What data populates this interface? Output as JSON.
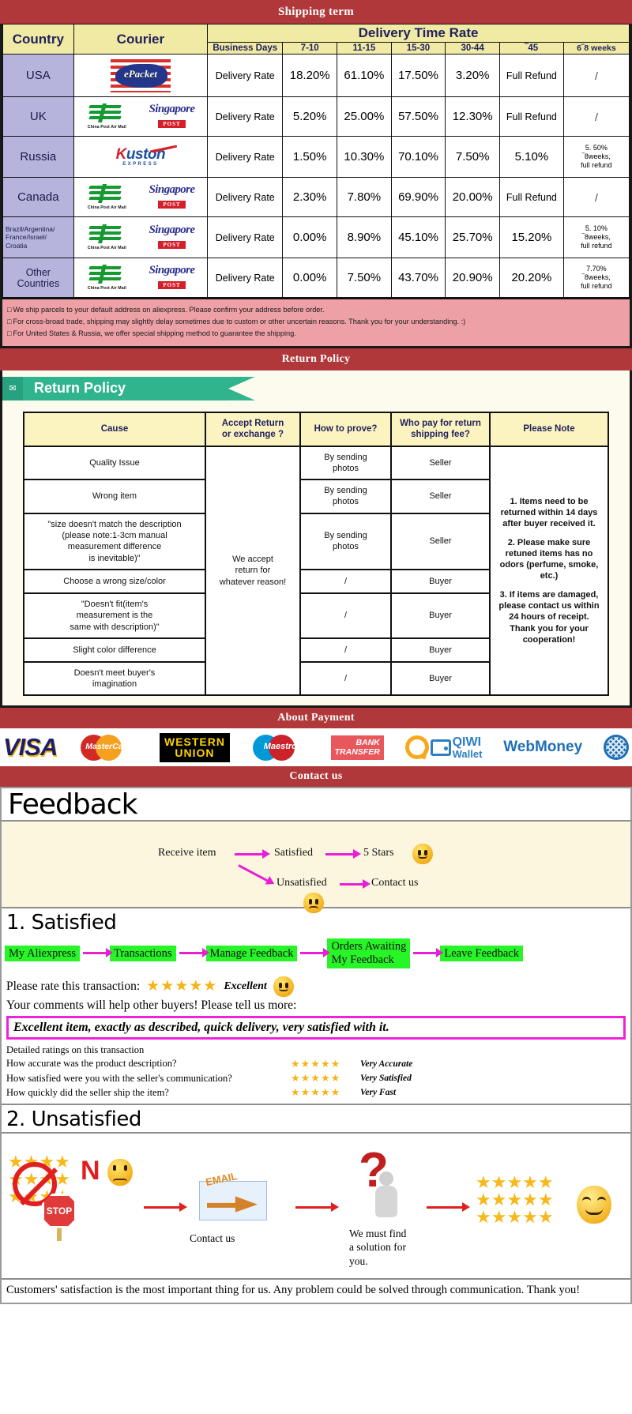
{
  "banners": {
    "shipping": "Shipping term",
    "return": "Return Policy",
    "payment": "About Payment",
    "contact": "Contact us"
  },
  "shipping_table": {
    "headers": {
      "country": "Country",
      "courier": "Courier",
      "group": "Delivery Time Rate",
      "business_days": "Business Days",
      "cols": [
        "7-10",
        "11-15",
        "15-30",
        "30-44",
        "‾45",
        "6‾8 weeks"
      ]
    },
    "rows": [
      {
        "country": "USA",
        "country_small": false,
        "couriers": [
          "epacket"
        ],
        "label": "Delivery Rate",
        "values": [
          "18.20%",
          "61.10%",
          "17.50%",
          "3.20%"
        ],
        "over45": "Full Refund",
        "weeks68": "/"
      },
      {
        "country": "UK",
        "country_small": false,
        "couriers": [
          "china-post",
          "singapore-post"
        ],
        "label": "Delivery Rate",
        "values": [
          "5.20%",
          "25.00%",
          "57.50%",
          "12.30%"
        ],
        "over45": "Full Refund",
        "weeks68": "/"
      },
      {
        "country": "Russia",
        "country_small": false,
        "couriers": [
          "kuston"
        ],
        "label": "Delivery Rate",
        "values": [
          "1.50%",
          "10.30%",
          "70.10%",
          "7.50%"
        ],
        "over45": "5.10%",
        "weeks68": "5. 50%\n‾8weeks,\nfull refund"
      },
      {
        "country": "Canada",
        "country_small": false,
        "couriers": [
          "china-post",
          "singapore-post"
        ],
        "label": "Delivery Rate",
        "values": [
          "2.30%",
          "7.80%",
          "69.90%",
          "20.00%"
        ],
        "over45": "Full Refund",
        "weeks68": "/"
      },
      {
        "country": "Brazil/Argentina/\nFrance/Israel/\nCroatia",
        "country_small": true,
        "couriers": [
          "china-post",
          "singapore-post"
        ],
        "label": "Delivery Rate",
        "values": [
          "0.00%",
          "8.90%",
          "45.10%",
          "25.70%"
        ],
        "over45": "15.20%",
        "weeks68": "5. 10%\n‾8weeks,\nfull refund"
      },
      {
        "country": "Other Countries",
        "country_small": false,
        "couriers": [
          "china-post",
          "singapore-post"
        ],
        "label": "Delivery Rate",
        "values": [
          "0.00%",
          "7.50%",
          "43.70%",
          "20.90%"
        ],
        "over45": "20.20%",
        "weeks68": "7.70%\n‾8weeks,\nfull refund"
      }
    ],
    "disclaimer": [
      "We ship parcels to your default address on aliexpress. Please confirm your address before order.",
      "For cross-broad trade, shipping may slightly delay sometimes due to custom or other uncertain reasons. Thank you for your understanding. :)",
      "For United States & Russia, we offer special shipping method to guarantee the shipping."
    ]
  },
  "return_policy": {
    "ribbon_label": "Return Policy",
    "ribbon_icon": "mail-icon",
    "headers": [
      "Cause",
      "Accept Return\nor exchange ?",
      "How to prove?",
      "Who pay for return\nshipping fee?",
      "Please Note"
    ],
    "accept_cell": "We accept\nreturn for\nwhatever reason!",
    "rows": [
      {
        "cause": "Quality Issue",
        "prove": "By sending\nphotos",
        "payer": "Seller"
      },
      {
        "cause": "Wrong item",
        "prove": "By sending\nphotos",
        "payer": "Seller"
      },
      {
        "cause": "\"size doesn't match the description\n(please note:1-3cm manual\nmeasurement difference\nis inevitable)\"",
        "prove": "By sending\nphotos",
        "payer": "Seller"
      },
      {
        "cause": "Choose a wrong size/color",
        "prove": "/",
        "payer": "Buyer"
      },
      {
        "cause": "\"Doesn't fit(item's\nmeasurement is the\nsame with description)\"",
        "prove": "/",
        "payer": "Buyer"
      },
      {
        "cause": "Slight color difference",
        "prove": "/",
        "payer": "Buyer"
      },
      {
        "cause": "Doesn't meet buyer's\nimagination",
        "prove": "/",
        "payer": "Buyer"
      }
    ],
    "notes": [
      "1. Items need to be returned within 14 days after buyer received it.",
      "2. Please make sure retuned items has no odors (perfume, smoke, etc.)",
      "3. If items are damaged, please contact us within 24 hours of receipt.\nThank you for your cooperation!"
    ]
  },
  "payment": {
    "methods": [
      {
        "name": "visa-logo",
        "label": "VISA"
      },
      {
        "name": "mastercard-logo",
        "label": "MasterCard"
      },
      {
        "name": "western-union-logo",
        "label_1": "WESTERN",
        "label_2": "UNION"
      },
      {
        "name": "maestro-logo",
        "label": "Maestro"
      },
      {
        "name": "bank-transfer-logo",
        "label_1": "BANK",
        "label_2": "TRANSFER"
      },
      {
        "name": "qiwi-wallet-logo",
        "label_1": "QIWI",
        "label_2": "Wallet"
      },
      {
        "name": "webmoney-logo",
        "label": "WebMoney"
      }
    ]
  },
  "feedback": {
    "title": "Feedback",
    "flow": {
      "receive": "Receive item",
      "satisfied": "Satisfied",
      "five_stars": "5 Stars",
      "unsatisfied": "Unsatisfied",
      "contact": "Contact us"
    },
    "satisfied": {
      "heading": "1. Satisfied",
      "steps": [
        "My Aliexpress",
        "Transactions",
        "Manage Feedback",
        "Orders Awaiting\nMy Feedback",
        "Leave Feedback"
      ],
      "rate_prompt": "Please rate this transaction:",
      "stars": "★★★★★",
      "rate_word": "Excellent",
      "tell_us": "Your comments will help other buyers! Please tell us more:",
      "comment": "Excellent item, exactly as described, quick delivery, very satisfied with it.",
      "detail_title": "Detailed ratings on this transaction",
      "detail_rows": [
        {
          "question": "How accurate was the product description?",
          "stars": "★★★★★",
          "answer": "Very Accurate"
        },
        {
          "question": "How satisfied were you with the seller's communication?",
          "stars": "★★★★★",
          "answer": "Very Satisfied"
        },
        {
          "question": "How quickly did the seller ship the item?",
          "stars": "★★★★★",
          "answer": "Very Fast"
        }
      ]
    },
    "unsatisfied": {
      "heading": "2. Unsatisfied",
      "no_label": "N",
      "stop_label": "STOP",
      "email_label": "EMAIL",
      "contact_caption": "Contact us",
      "solution_caption": "We must find\na solution for\nyou.",
      "good_stars": "★★★★★",
      "bad_stars_row": "★★★★",
      "closing": "Customers' satisfaction is the most important thing for us. Any problem could be solved through communication. Thank you!"
    }
  },
  "colors": {
    "band_red": "#b0383a",
    "header_yellow": "#f0eaa4",
    "country_purple": "#b6b4dd",
    "disclaimer_pink": "#eda0a6",
    "ribbon_green": "#2fb48e",
    "step_green": "#27f527",
    "magenta": "#e91fd6",
    "star_gold": "#f5b317"
  }
}
